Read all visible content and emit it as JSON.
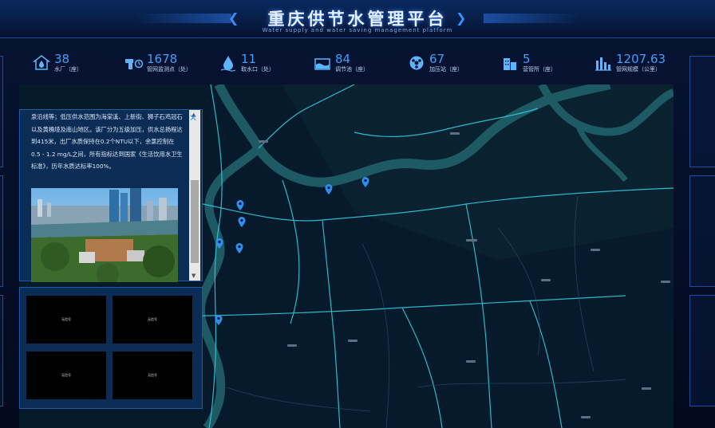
{
  "header": {
    "title": "重庆供节水管理平台",
    "subtitle": "Water supply and water saving management platform"
  },
  "stats": [
    {
      "value": "38",
      "label": "水厂（座）",
      "icon": "water-plant-icon"
    },
    {
      "value": "1678",
      "label": "管网监测点（处）",
      "icon": "pipe-monitor-icon"
    },
    {
      "value": "11",
      "label": "取水口（处）",
      "icon": "water-drop-icon"
    },
    {
      "value": "84",
      "label": "调节池（座）",
      "icon": "pool-icon"
    },
    {
      "value": "67",
      "label": "加压站（座）",
      "icon": "pump-station-icon"
    },
    {
      "value": "5",
      "label": "营管所（座）",
      "icon": "office-building-icon"
    },
    {
      "value": "1207.63",
      "label": "管网规模（公里）",
      "icon": "network-scale-icon"
    }
  ],
  "info": {
    "description": "泉沿线等；低压供水范围为海棠溪、上新街、狮子石鸡冠石以及黄桷垭及南山地区。该厂分为五级加压，供水总扬程达到415米，出厂水质保持在0.2个NTU以下，余氯控制在0.5 - 1.2 mg/L之间，所有指标达到国家《生活饮用水卫生标准》，历年水质达标率100%。"
  },
  "videos": [
    {
      "label": "无信号"
    },
    {
      "label": "无信号"
    },
    {
      "label": "无信号"
    },
    {
      "label": "无信号"
    }
  ],
  "colors": {
    "accent": "#3fa0ff",
    "river": "#1d5a64",
    "road": "#34d3e6",
    "map_bg": "#071a2c"
  }
}
